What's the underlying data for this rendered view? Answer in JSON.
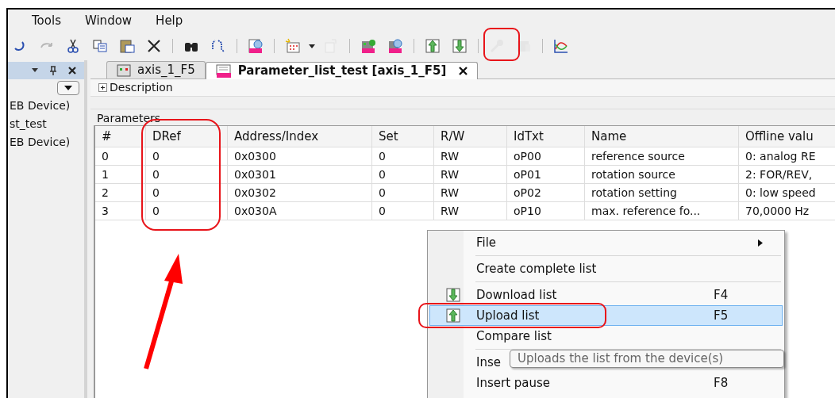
{
  "menu_bar": [
    "Tools",
    "Window",
    "Help"
  ],
  "toolbar": [
    {
      "kind": "button",
      "disabled": false
    },
    {
      "kind": "button",
      "disabled": true
    },
    {
      "kind": "button",
      "disabled": false
    },
    {
      "kind": "button",
      "disabled": false
    },
    {
      "kind": "button",
      "disabled": false
    },
    {
      "kind": "button",
      "disabled": false
    },
    {
      "kind": "separator"
    },
    {
      "kind": "button",
      "disabled": false
    },
    {
      "kind": "button",
      "disabled": false
    },
    {
      "kind": "separator"
    },
    {
      "kind": "button",
      "disabled": false
    },
    {
      "kind": "separator"
    },
    {
      "kind": "button",
      "disabled": false
    },
    {
      "kind": "button",
      "disabled": true
    },
    {
      "kind": "separator"
    },
    {
      "kind": "button",
      "disabled": false
    },
    {
      "kind": "button",
      "disabled": false
    },
    {
      "kind": "separator"
    },
    {
      "kind": "button",
      "disabled": false
    },
    {
      "kind": "button",
      "disabled": false
    },
    {
      "kind": "separator"
    },
    {
      "kind": "button",
      "disabled": true
    },
    {
      "kind": "button",
      "disabled": true
    },
    {
      "kind": "separator"
    },
    {
      "kind": "button",
      "disabled": false
    }
  ],
  "sidebar": {
    "items": [
      "EB Device)",
      "st_test",
      "EB Device)"
    ]
  },
  "tabs": [
    {
      "label": "axis_1_F5",
      "selected": false
    },
    {
      "label": "Parameter_list_test [axis_1_F5]",
      "selected": true
    }
  ],
  "description": {
    "label": "Description",
    "expanded": false
  },
  "parameters_label": "Parameters",
  "table": {
    "columns": [
      "#",
      "DRef",
      "Address/Index",
      "Set",
      "R/W",
      "IdTxt",
      "Name",
      "Offline valu"
    ],
    "rows": [
      [
        "0",
        "0",
        "0x0300",
        "0",
        "RW",
        "oP00",
        "reference source",
        "0: analog RE"
      ],
      [
        "1",
        "0",
        "0x0301",
        "0",
        "RW",
        "oP01",
        "rotation source",
        "2: FOR/REV,"
      ],
      [
        "2",
        "0",
        "0x0302",
        "0",
        "RW",
        "oP02",
        "rotation setting",
        "0: low speed"
      ],
      [
        "3",
        "0",
        "0x030A",
        "0",
        "RW",
        "oP10",
        "max. reference fo...",
        "70,0000 Hz"
      ]
    ]
  },
  "context_menu": {
    "items": [
      {
        "kind": "submenu",
        "label": "File",
        "selected": false
      },
      {
        "kind": "separator"
      },
      {
        "kind": "item",
        "label": "Create complete list",
        "selected": false
      },
      {
        "kind": "separator"
      },
      {
        "kind": "item",
        "label": "Download list",
        "shortcut": "F4",
        "selected": false
      },
      {
        "kind": "item",
        "label": "Upload list",
        "shortcut": "F5",
        "selected": true
      },
      {
        "kind": "item",
        "label": "Compare list",
        "selected": false
      },
      {
        "kind": "separator"
      },
      {
        "kind": "item",
        "label": "Inse",
        "selected": false
      },
      {
        "kind": "item",
        "label": "Insert pause",
        "shortcut": "F8",
        "selected": false
      }
    ]
  },
  "tooltip": "Uploads the list from the device(s)"
}
